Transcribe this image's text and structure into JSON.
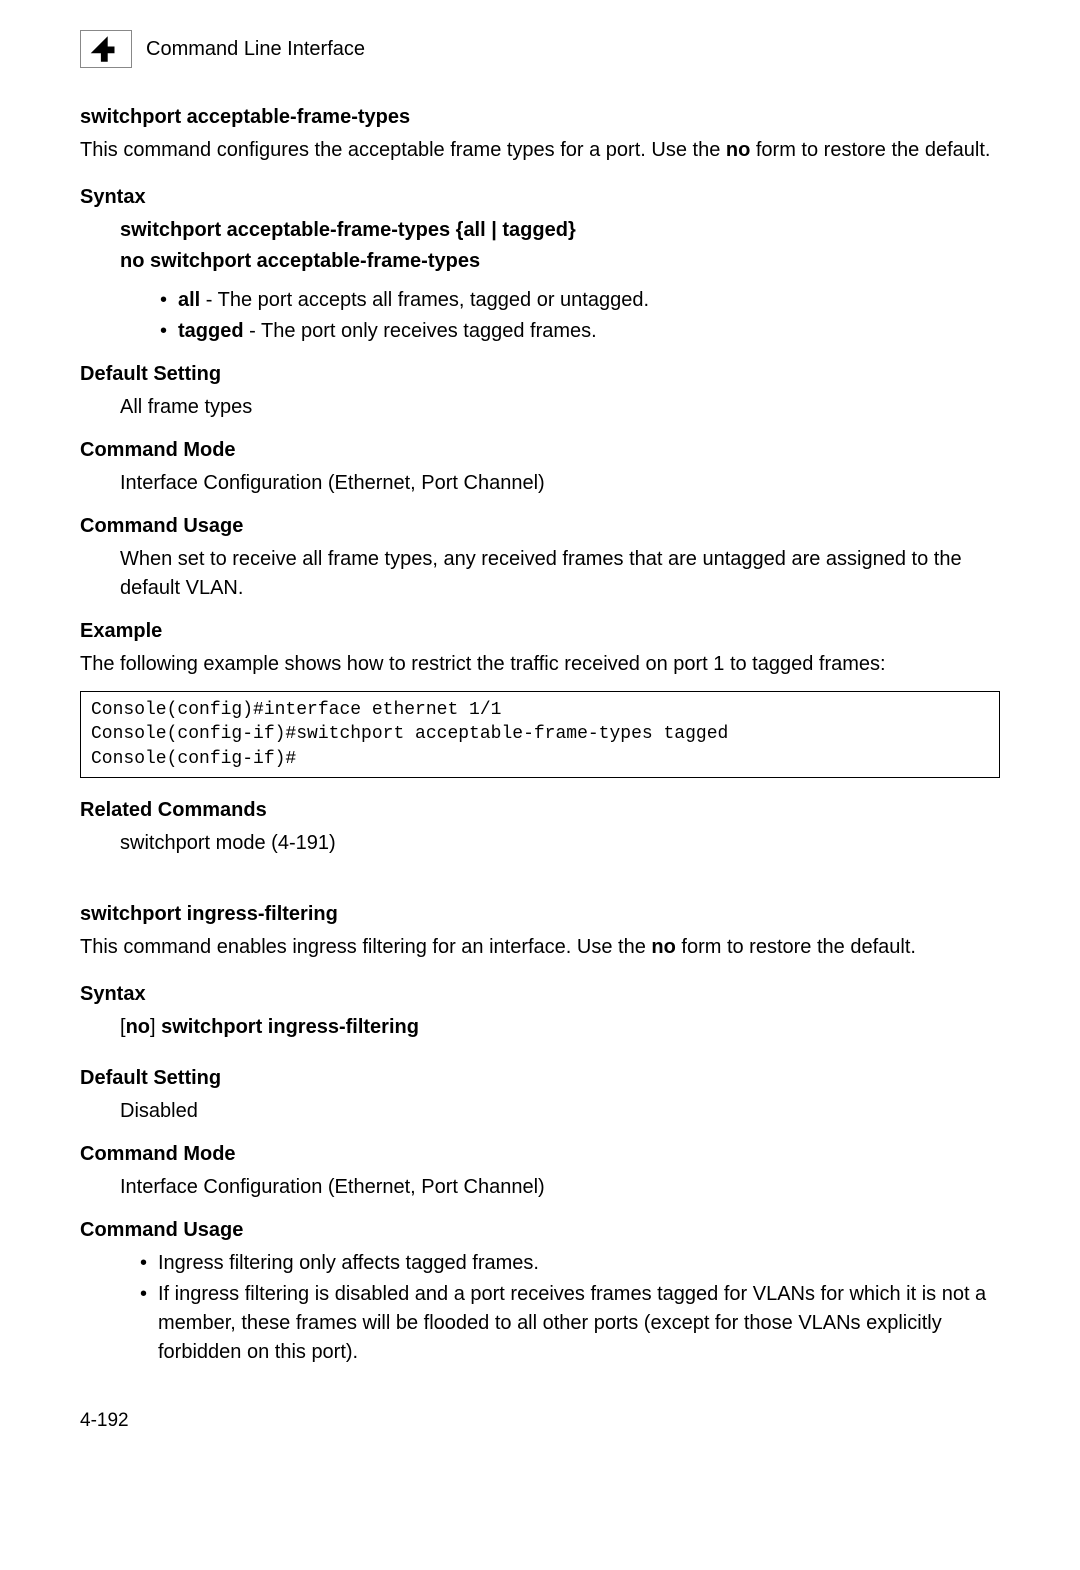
{
  "header": {
    "title": "Command Line Interface"
  },
  "cmd1": {
    "title": "switchport acceptable-frame-types",
    "desc_pre": "This command configures the acceptable frame types for a port. Use the ",
    "desc_bold": "no",
    "desc_post": " form to restore the default.",
    "syntax_heading": "Syntax",
    "syntax_line1": "switchport acceptable-frame-types {all | tagged}",
    "syntax_line2": "no switchport acceptable-frame-types",
    "param_all_b": "all",
    "param_all_t": " - The port accepts all frames, tagged or untagged.",
    "param_tagged_b": "tagged",
    "param_tagged_t": " - The port only receives tagged frames.",
    "default_heading": "Default Setting",
    "default_value": "All frame types",
    "mode_heading": "Command Mode",
    "mode_value": "Interface Configuration (Ethernet, Port Channel)",
    "usage_heading": "Command Usage",
    "usage_text": "When set to receive all frame types, any received frames that are untagged are assigned to the default VLAN.",
    "example_heading": "Example",
    "example_intro": "The following example shows how to restrict the traffic received on port 1 to tagged frames:",
    "example_code": "Console(config)#interface ethernet 1/1\nConsole(config-if)#switchport acceptable-frame-types tagged\nConsole(config-if)#",
    "related_heading": "Related Commands",
    "related_value": "switchport mode (4-191)"
  },
  "cmd2": {
    "title": "switchport ingress-filtering",
    "desc_pre": "This command enables ingress filtering for an interface. Use the ",
    "desc_bold": "no",
    "desc_post": " form to restore the default.",
    "syntax_heading": "Syntax",
    "syntax_line": "[no] switchport ingress-filtering",
    "default_heading": "Default Setting",
    "default_value": "Disabled",
    "mode_heading": "Command Mode",
    "mode_value": "Interface Configuration (Ethernet, Port Channel)",
    "usage_heading": "Command Usage",
    "usage_item1": "Ingress filtering only affects tagged frames.",
    "usage_item2": "If ingress filtering is disabled and a port receives frames tagged for VLANs for which it is not a member, these frames will be flooded to all other ports (except for those VLANs explicitly forbidden on this port)."
  },
  "page_number": "4-192"
}
